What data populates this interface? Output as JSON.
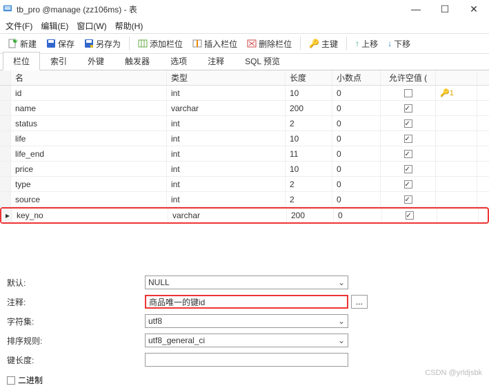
{
  "window": {
    "title": "tb_pro @manage (zz106ms) - 表"
  },
  "menu": {
    "file": "文件(F)",
    "edit": "编辑(E)",
    "window": "窗口(W)",
    "help": "帮助(H)"
  },
  "toolbar": {
    "new": "新建",
    "save": "保存",
    "saveas": "另存为",
    "addcol": "添加栏位",
    "insertcol": "插入栏位",
    "delcol": "删除栏位",
    "pk": "主键",
    "up": "上移",
    "down": "下移"
  },
  "tabs": [
    "栏位",
    "索引",
    "外键",
    "触发器",
    "选项",
    "注释",
    "SQL 预览"
  ],
  "grid": {
    "headers": {
      "name": "名",
      "type": "类型",
      "len": "长度",
      "dec": "小数点",
      "null": "允许空值 ("
    },
    "rows": [
      {
        "name": "id",
        "type": "int",
        "len": "10",
        "dec": "0",
        "null": false,
        "key": "1"
      },
      {
        "name": "name",
        "type": "varchar",
        "len": "200",
        "dec": "0",
        "null": true
      },
      {
        "name": "status",
        "type": "int",
        "len": "2",
        "dec": "0",
        "null": true
      },
      {
        "name": "life",
        "type": "int",
        "len": "10",
        "dec": "0",
        "null": true
      },
      {
        "name": "life_end",
        "type": "int",
        "len": "11",
        "dec": "0",
        "null": true
      },
      {
        "name": "price",
        "type": "int",
        "len": "10",
        "dec": "0",
        "null": true
      },
      {
        "name": "type",
        "type": "int",
        "len": "2",
        "dec": "0",
        "null": true
      },
      {
        "name": "source",
        "type": "int",
        "len": "2",
        "dec": "0",
        "null": true
      },
      {
        "name": "key_no",
        "type": "varchar",
        "len": "200",
        "dec": "0",
        "null": true,
        "current": true
      }
    ]
  },
  "form": {
    "default_label": "默认:",
    "default_value": "NULL",
    "comment_label": "注释:",
    "comment_value": "商品唯一的键id",
    "charset_label": "字符集:",
    "charset_value": "utf8",
    "collation_label": "排序规则:",
    "collation_value": "utf8_general_ci",
    "keylen_label": "键长度:",
    "binary_label": "二进制"
  },
  "watermark": "CSDN @yrldjsbk"
}
